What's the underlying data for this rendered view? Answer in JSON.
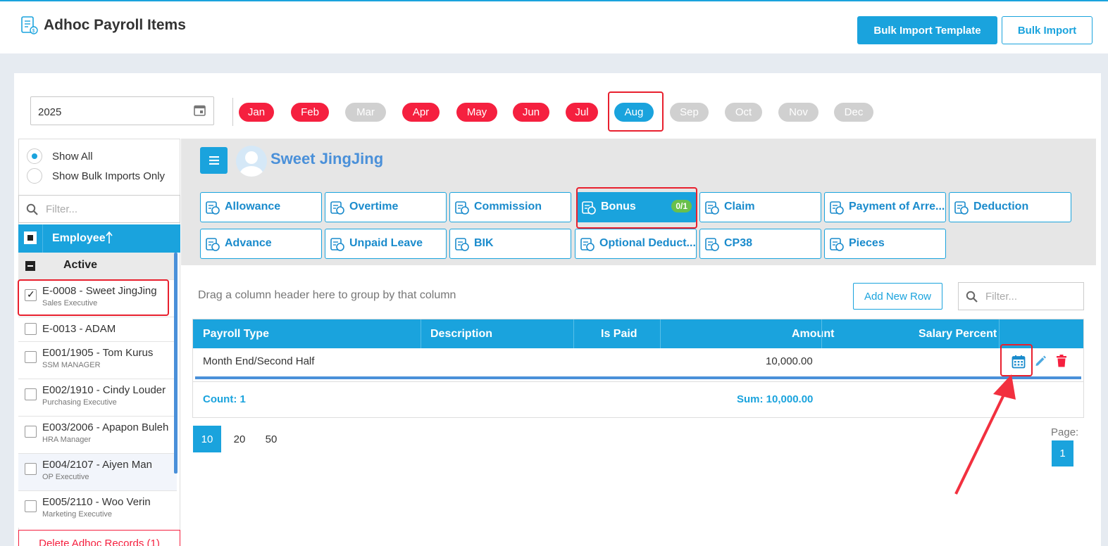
{
  "header": {
    "title": "Adhoc Payroll Items",
    "bulk_import_template_label": "Bulk Import Template",
    "bulk_import_label": "Bulk Import"
  },
  "year": {
    "value": "2025"
  },
  "months": [
    {
      "label": "Jan",
      "state": "red"
    },
    {
      "label": "Feb",
      "state": "red"
    },
    {
      "label": "Mar",
      "state": "gray"
    },
    {
      "label": "Apr",
      "state": "red"
    },
    {
      "label": "May",
      "state": "red"
    },
    {
      "label": "Jun",
      "state": "red"
    },
    {
      "label": "Jul",
      "state": "red"
    },
    {
      "label": "Aug",
      "state": "selected"
    },
    {
      "label": "Sep",
      "state": "gray"
    },
    {
      "label": "Oct",
      "state": "gray"
    },
    {
      "label": "Nov",
      "state": "gray"
    },
    {
      "label": "Dec",
      "state": "gray"
    }
  ],
  "left_panel": {
    "show_all_label": "Show All",
    "show_bulk_label": "Show Bulk Imports Only",
    "filter_placeholder": "Filter...",
    "employee_header": "Employee",
    "group_label": "Active",
    "employees": [
      {
        "name": "E-0008 - Sweet JingJing",
        "role": "Sales Executive",
        "checked": true
      },
      {
        "name": "E-0013 - ADAM",
        "role": "",
        "checked": false
      },
      {
        "name": "E001/1905 - Tom Kurus",
        "role": "SSM MANAGER",
        "checked": false
      },
      {
        "name": "E002/1910 - Cindy Louder",
        "role": "Purchasing Executive",
        "checked": false
      },
      {
        "name": "E003/2006 - Apapon Buleh",
        "role": "HRA Manager",
        "checked": false
      },
      {
        "name": "E004/2107 - Aiyen Man",
        "role": "OP Executive",
        "checked": false
      },
      {
        "name": "E005/2110 - Woo Verin",
        "role": "Marketing Executive",
        "checked": false
      }
    ],
    "delete_label": "Delete Adhoc Records (1)"
  },
  "employee": {
    "name": "Sweet JingJing"
  },
  "categories": [
    {
      "label": "Allowance",
      "icon": "allowance-icon"
    },
    {
      "label": "Overtime",
      "icon": "overtime-icon"
    },
    {
      "label": "Commission",
      "icon": "commission-icon"
    },
    {
      "label": "Bonus",
      "icon": "bonus-icon",
      "badge": "0/1"
    },
    {
      "label": "Claim",
      "icon": "claim-icon"
    },
    {
      "label": "Payment of Arre...",
      "icon": "arrears-icon"
    },
    {
      "label": "Deduction",
      "icon": "deduction-icon"
    },
    {
      "label": "Advance",
      "icon": "advance-icon"
    },
    {
      "label": "Unpaid Leave",
      "icon": "unpaid-leave-icon"
    },
    {
      "label": "BIK",
      "icon": "bik-icon"
    },
    {
      "label": "Optional Deduct...",
      "icon": "optional-deduction-icon"
    },
    {
      "label": "CP38",
      "icon": "cp38-icon"
    },
    {
      "label": "Pieces",
      "icon": "pieces-icon"
    }
  ],
  "grid": {
    "drag_hint": "Drag a column header here to group by that column",
    "add_row_label": "Add New Row",
    "filter_placeholder": "Filter...",
    "columns": [
      "Payroll Type",
      "Description",
      "Is Paid",
      "Amount",
      "Salary Percent"
    ],
    "rows": [
      {
        "payroll_type": "Month End/Second Half",
        "description": "",
        "is_paid": "",
        "amount": "10,000.00",
        "salary_percent": ""
      }
    ],
    "count": "Count: 1",
    "sum": "Sum: 10,000.00"
  },
  "pagination": {
    "sizes": [
      "10",
      "20",
      "50"
    ],
    "active_size": "10",
    "page_label": "Page:",
    "current_page": "1"
  },
  "colors": {
    "accent": "#1aa3dd",
    "month_active": "#f5203f",
    "month_inactive": "#d0d0d0",
    "badge": "#69c04b",
    "highlight": "#e8202e"
  }
}
